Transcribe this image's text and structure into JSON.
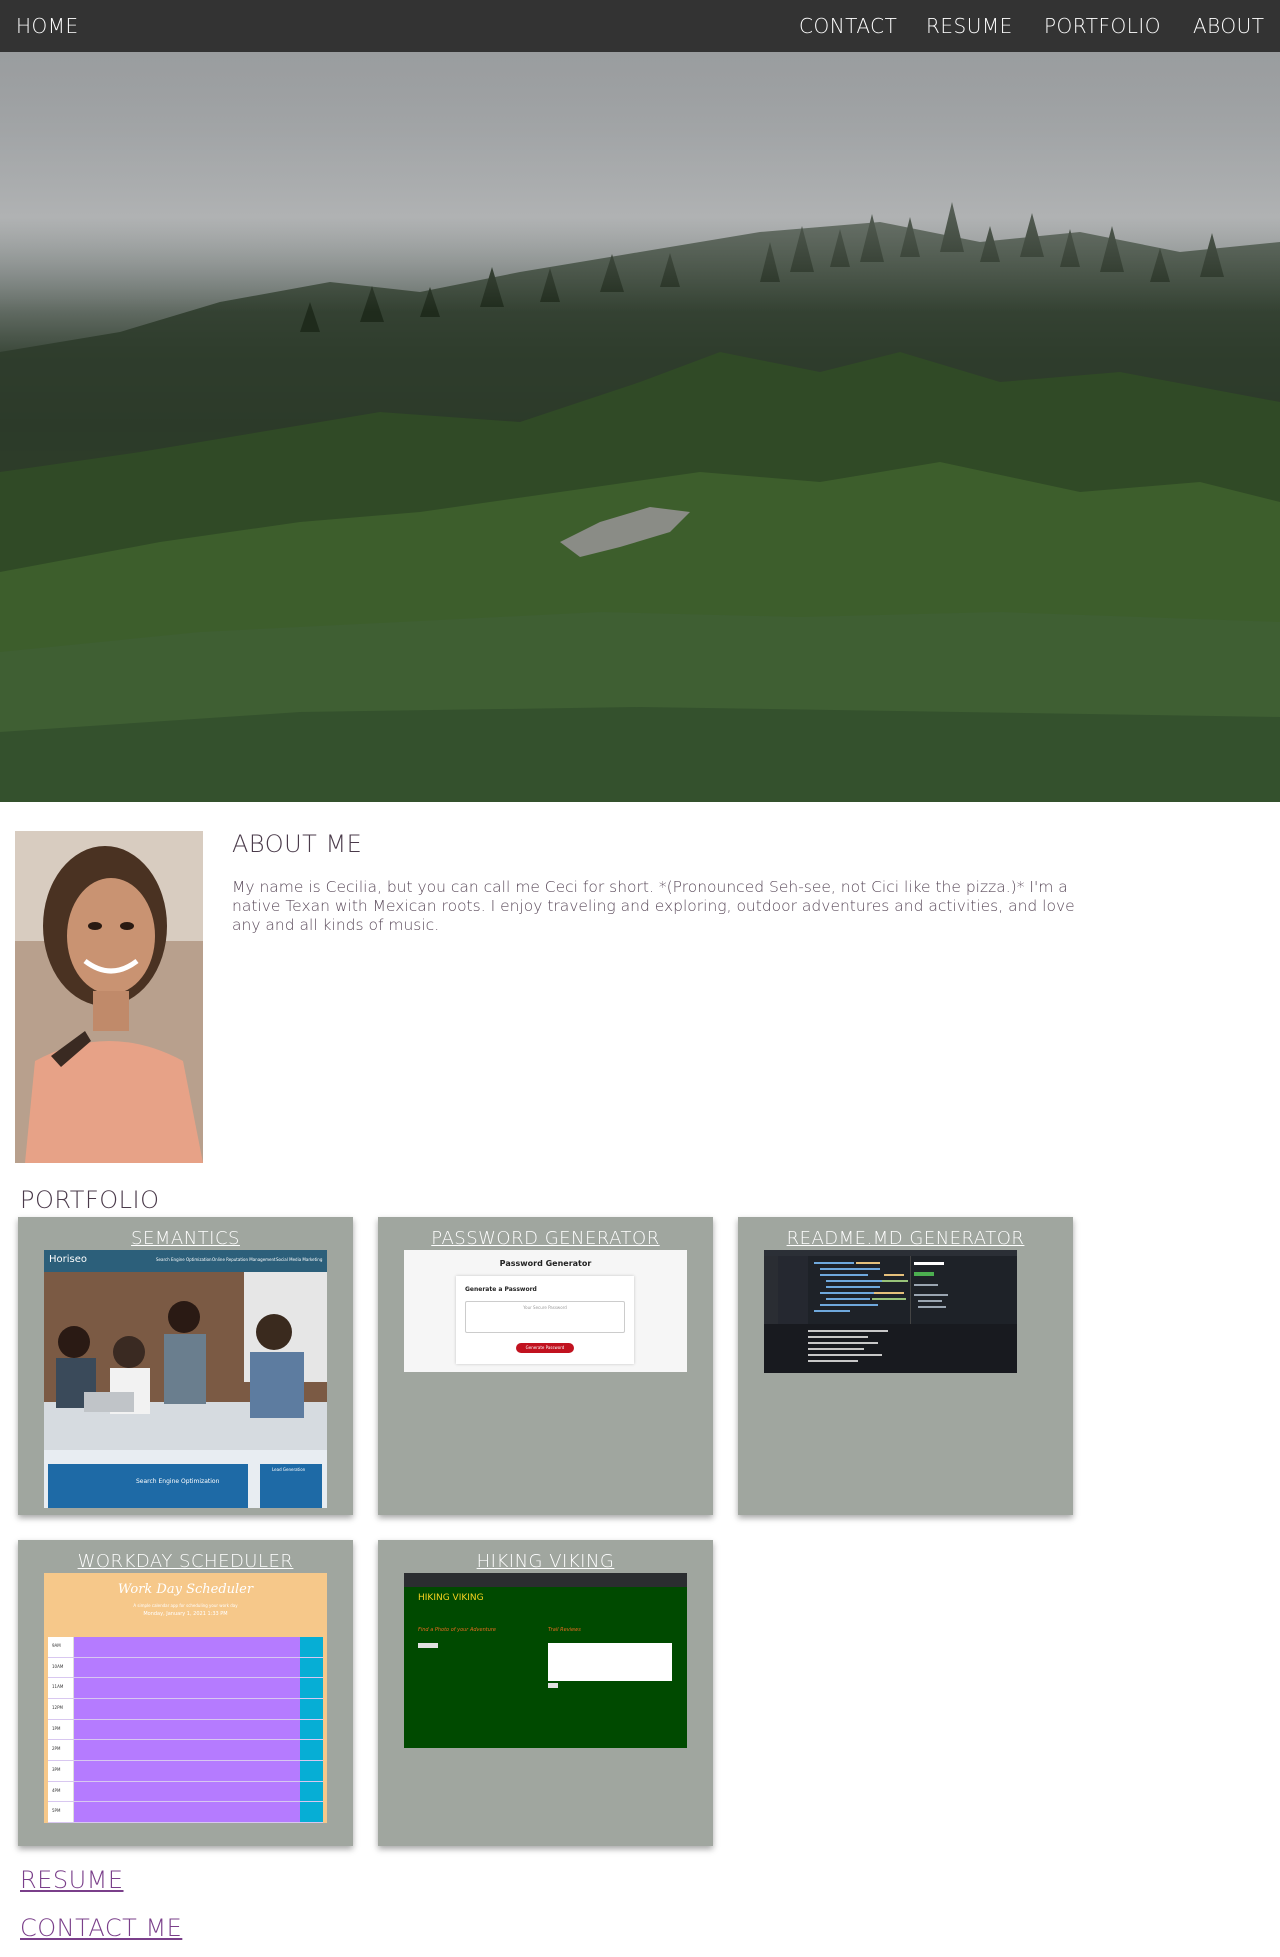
{
  "nav": {
    "home": "HOME",
    "contact": "CONTACT",
    "resume": "RESUME",
    "portfolio": "PORTFOLIO",
    "about": "ABOUT"
  },
  "about": {
    "title": "ABOUT ME",
    "text": "My name is Cecilia, but you can call me Ceci for short. *(Pronounced Seh-see, not Cici like the pizza.)* I'm a native Texan with Mexican roots. I enjoy traveling and exploring, outdoor adventures and activities, and love any and all kinds of music."
  },
  "portfolio": {
    "title": "PORTFOLIO",
    "projects": [
      {
        "title": "SEMANTICS",
        "thumb": {
          "brand": "Horiseo",
          "nav": [
            "Search Engine Optimization",
            "Online Reputation Management",
            "Social Media Marketing"
          ],
          "section": "Search Engine Optimization",
          "side": "Lead Generation"
        }
      },
      {
        "title": "PASSWORD GENERATOR",
        "thumb": {
          "heading": "Password Generator",
          "subheading": "Generate a Password",
          "placeholder": "Your Secure Password",
          "button": "Generate Password"
        }
      },
      {
        "title": "README.MD GENERATOR",
        "thumb": {}
      },
      {
        "title": "WORKDAY SCHEDULER",
        "thumb": {
          "heading": "Work Day Scheduler",
          "subheading": "A simple calendar app for scheduling your work day",
          "date": "Monday, January 1, 2021 1:33 PM",
          "hours": [
            "9AM",
            "10AM",
            "11AM",
            "12PM",
            "1PM",
            "2PM",
            "3PM",
            "4PM",
            "5PM"
          ]
        }
      },
      {
        "title": "HIKING VIKING",
        "thumb": {
          "brand": "HIKING VIKING",
          "left_heading": "Find a Photo of your Adventure",
          "right_heading": "Trail Reviews"
        }
      }
    ]
  },
  "links": {
    "resume": "RESUME",
    "contact": "CONTACT ME"
  },
  "colors": {
    "nav_bg": "#333333",
    "card_bg": "#a0a69f",
    "link_purple": "#7a3f8a",
    "text_dark": "#4a3a4a"
  }
}
